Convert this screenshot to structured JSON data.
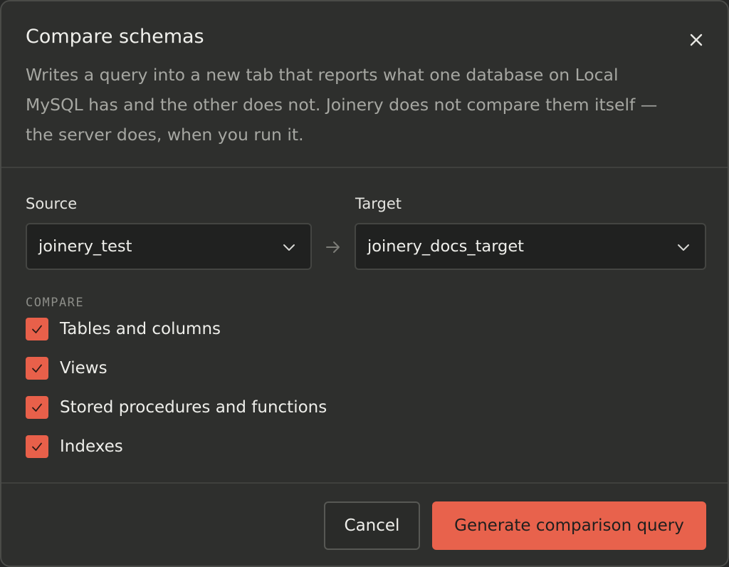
{
  "dialog": {
    "title": "Compare schemas",
    "description": "Writes a query into a new tab that reports what one database on Local MySQL has and the other does not. Joinery does not compare them itself — the server does, when you run it."
  },
  "source": {
    "label": "Source",
    "value": "joinery_test"
  },
  "target": {
    "label": "Target",
    "value": "joinery_docs_target"
  },
  "compare": {
    "label": "COMPARE",
    "options": [
      {
        "label": "Tables and columns",
        "checked": true
      },
      {
        "label": "Views",
        "checked": true
      },
      {
        "label": "Stored procedures and functions",
        "checked": true
      },
      {
        "label": "Indexes",
        "checked": true
      }
    ]
  },
  "actions": {
    "cancel_label": "Cancel",
    "generate_label": "Generate comparison query"
  },
  "colors": {
    "accent": "#e8604a",
    "background": "#2e2f2d",
    "input_background": "#202120"
  },
  "icons": {
    "close": "close-icon",
    "chevron": "chevron-down-icon",
    "arrow": "arrow-right-icon",
    "check": "check-icon"
  }
}
